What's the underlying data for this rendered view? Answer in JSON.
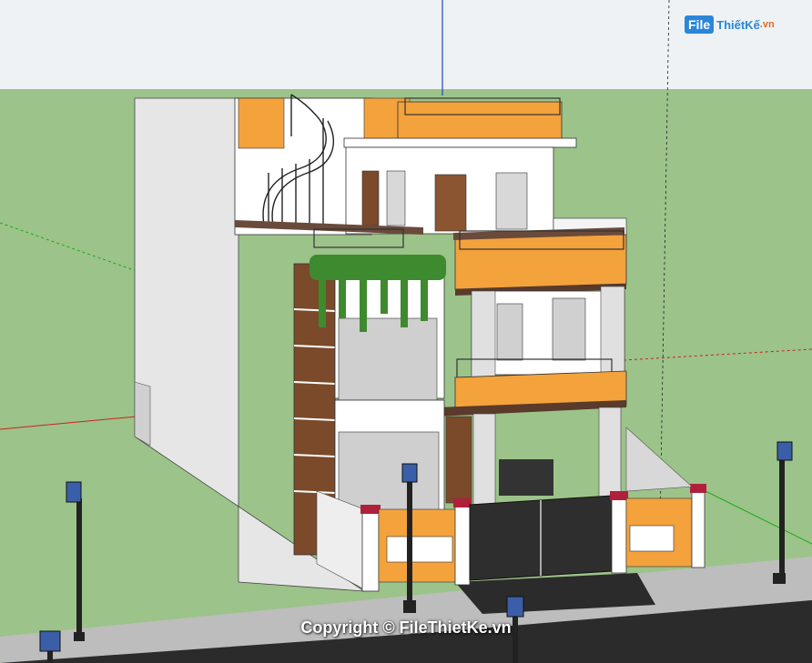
{
  "logo": {
    "file": "File",
    "name": "ThiếtKế",
    "domain": ".vn"
  },
  "watermark": {
    "text": "Copyright © FileThietKe.vn"
  },
  "colors": {
    "sky": "#eef2f5",
    "grass": "#9cc38a",
    "wall_orange": "#f4a23c",
    "wall_white": "#ffffff",
    "wood": "#7a4a2a",
    "road": "#2b2b2b"
  }
}
